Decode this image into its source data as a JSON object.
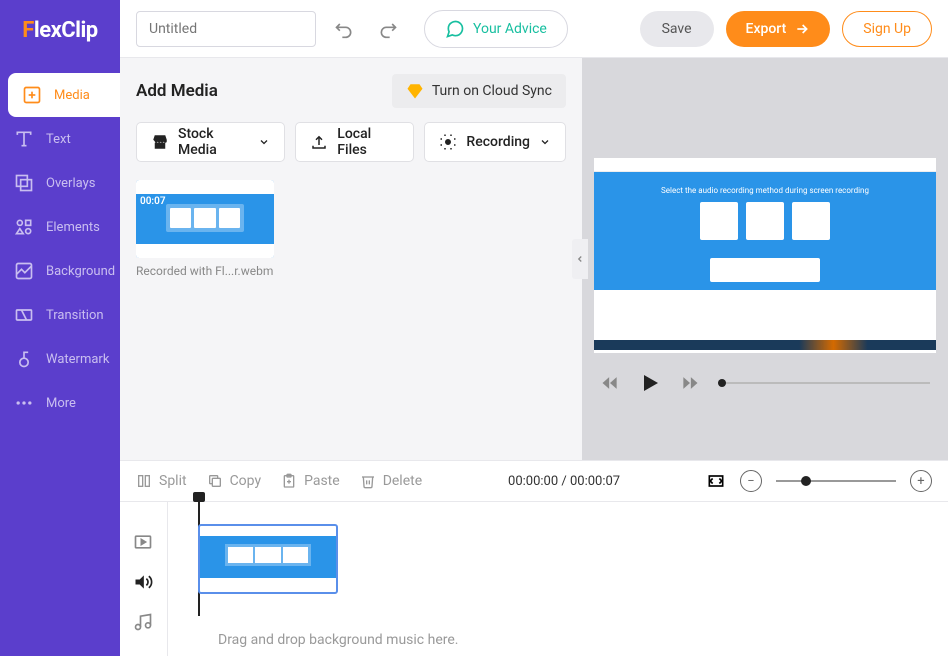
{
  "logo": {
    "brand": "FlexClip"
  },
  "topbar": {
    "title_placeholder": "Untitled",
    "title_value": "Untitled",
    "advice_label": "Your Advice",
    "save_label": "Save",
    "export_label": "Export",
    "signup_label": "Sign Up"
  },
  "sidebar": {
    "items": [
      {
        "label": "Media",
        "icon": "media-icon"
      },
      {
        "label": "Text",
        "icon": "text-icon"
      },
      {
        "label": "Overlays",
        "icon": "overlays-icon"
      },
      {
        "label": "Elements",
        "icon": "elements-icon"
      },
      {
        "label": "Background",
        "icon": "background-icon"
      },
      {
        "label": "Transition",
        "icon": "transition-icon"
      },
      {
        "label": "Watermark",
        "icon": "watermark-icon"
      },
      {
        "label": "More",
        "icon": "more-icon"
      }
    ]
  },
  "media": {
    "title": "Add Media",
    "cloud_label": "Turn on Cloud Sync",
    "sources": {
      "stock_label": "Stock Media",
      "local_label": "Local Files",
      "recording_label": "Recording"
    },
    "items": [
      {
        "name": "Recorded with Fl...r.webm",
        "duration": "00:07"
      }
    ]
  },
  "preview": {
    "canvas_text": "Select the audio recording method during screen recording"
  },
  "timeline_bar": {
    "split_label": "Split",
    "copy_label": "Copy",
    "paste_label": "Paste",
    "delete_label": "Delete",
    "time_current": "00:00:00",
    "time_total": "00:00:07"
  },
  "timeline": {
    "music_hint": "Drag and drop background music here."
  }
}
